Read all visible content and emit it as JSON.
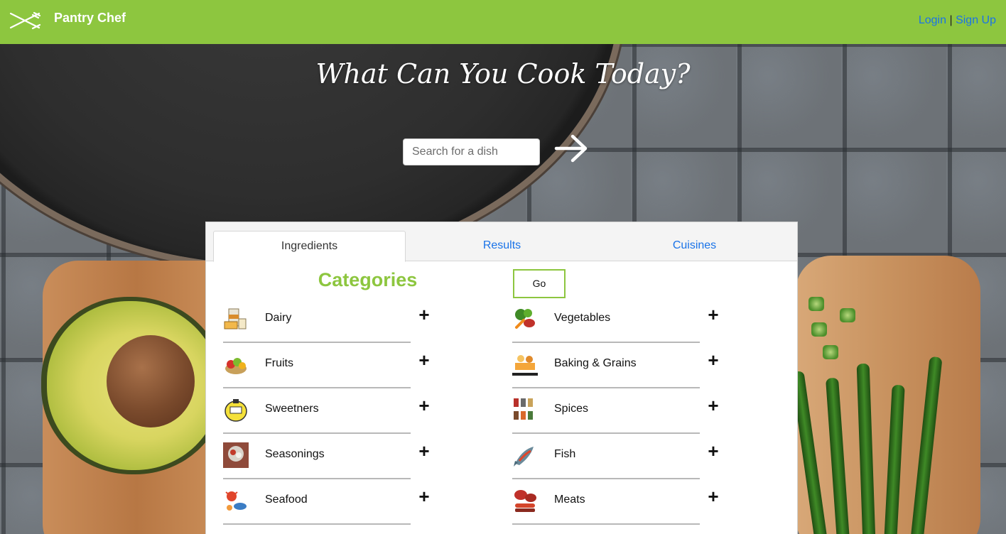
{
  "header": {
    "brand": "Pantry Chef",
    "login": "Login",
    "separator": "|",
    "signup": "Sign Up",
    "bg_color": "#8dc63f"
  },
  "hero": {
    "title": "What Can You Cook Today?",
    "search_placeholder": "Search for a dish",
    "submit_icon": "arrow-right-icon"
  },
  "tabs": [
    {
      "label": "Ingredients",
      "active": true
    },
    {
      "label": "Results",
      "active": false
    },
    {
      "label": "Cuisines",
      "active": false
    }
  ],
  "categories": {
    "heading": "Categories",
    "go_label": "Go",
    "left": [
      {
        "label": "Dairy",
        "icon": "dairy-icon"
      },
      {
        "label": "Fruits",
        "icon": "fruits-icon"
      },
      {
        "label": "Sweetners",
        "icon": "sweeteners-icon"
      },
      {
        "label": "Seasonings",
        "icon": "seasonings-icon"
      },
      {
        "label": "Seafood",
        "icon": "seafood-icon"
      }
    ],
    "right": [
      {
        "label": "Vegetables",
        "icon": "vegetables-icon"
      },
      {
        "label": "Baking & Grains",
        "icon": "baking-grains-icon"
      },
      {
        "label": "Spices",
        "icon": "spices-icon"
      },
      {
        "label": "Fish",
        "icon": "fish-icon"
      },
      {
        "label": "Meats",
        "icon": "meats-icon"
      }
    ],
    "expand_symbol": "+"
  }
}
